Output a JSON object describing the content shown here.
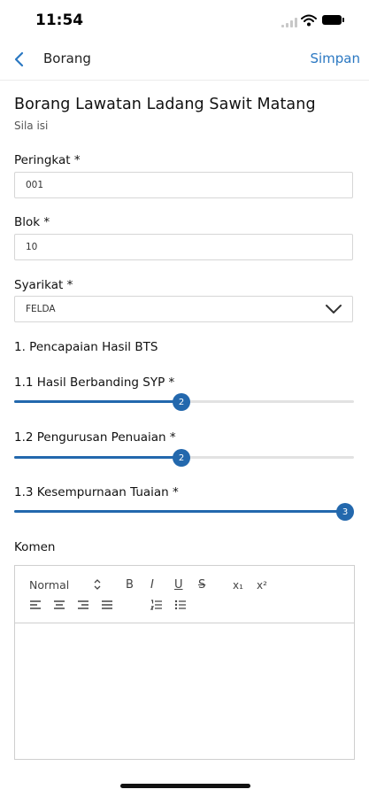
{
  "status_bar": {
    "time": "11:54"
  },
  "nav": {
    "title": "Borang",
    "save_label": "Simpan"
  },
  "form": {
    "title": "Borang Lawatan Ladang Sawit Matang",
    "subtitle": "Sila isi"
  },
  "fields": {
    "peringkat": {
      "label": "Peringkat *",
      "value": "001"
    },
    "blok": {
      "label": "Blok *",
      "value": "10"
    },
    "syarikat": {
      "label": "Syarikat *",
      "value": "FELDA"
    }
  },
  "section": {
    "heading": "1. Pencapaian Hasil BTS"
  },
  "sliders": [
    {
      "label": "1.1 Hasil Berbanding SYP *",
      "value": "2",
      "fraction": 0.505
    },
    {
      "label": "1.2 Pengurusan Penuaian *",
      "value": "2",
      "fraction": 0.505
    },
    {
      "label": "1.3 Kesempurnaan Tuaian *",
      "value": "3",
      "fraction": 1.0
    }
  ],
  "comment": {
    "label": "Komen",
    "toolbar": {
      "format_select": "Normal",
      "bold": "B",
      "italic": "I",
      "underline": "U",
      "strike": "S",
      "subscript": "x₁",
      "superscript": "x²"
    }
  },
  "colors": {
    "accent": "#2368ad",
    "link": "#2b78c2"
  }
}
